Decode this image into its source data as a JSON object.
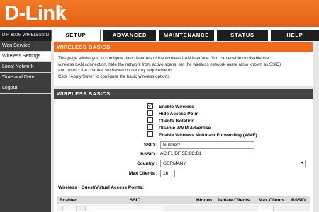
{
  "brand": {
    "logo_text": "D-Link"
  },
  "model": {
    "text": "DIR-600M WIRELESS N"
  },
  "tabs": [
    {
      "label": "SETUP",
      "active": true
    },
    {
      "label": "ADVANCED",
      "active": false
    },
    {
      "label": "MAINTENANCE",
      "active": false
    },
    {
      "label": "STATUS",
      "active": false
    },
    {
      "label": "HELP",
      "active": false
    }
  ],
  "sidebar": {
    "items": [
      {
        "label": "Wan Service"
      },
      {
        "label": "Wireless Settings",
        "active": true
      },
      {
        "label": "Local Network"
      },
      {
        "label": "Time and Date"
      },
      {
        "label": "Logout"
      }
    ]
  },
  "intro": {
    "title": "WIRELESS BASICS",
    "lines": [
      "This page allows you to configure basic features of the wireless LAN interface. You can enable or disable the",
      "wireless LAN connection, hide the network from active scans, set the wireless network name (also known as SSID)",
      "and restrict the channel set based on country requirements.",
      "Click \"Apply/Save\" to configure the basic wireless options."
    ]
  },
  "basics": {
    "title": "WIRELESS BASICS",
    "checkboxes": [
      {
        "label": "Enable Wireless",
        "checked": true
      },
      {
        "label": "Hide Access Point",
        "checked": false
      },
      {
        "label": "Clients Isolation",
        "checked": false
      },
      {
        "label": "Disable WMM Advertise",
        "checked": false
      },
      {
        "label": "Enable Wireless Multicast Forwarding (WMF)",
        "checked": false
      }
    ],
    "ssid_label": "SSID :",
    "ssid_value": "Nutmetz",
    "bssid_label": "BSSID :",
    "bssid_value": "AC:F1:DF:5E:6C:B1",
    "country_label": "Country :",
    "country_value": "GERMANY",
    "max_clients_label": "Max Clients :",
    "max_clients_value": "16",
    "guest_title": "Wireless - Guest/Virtual Access Points:",
    "guest_columns": [
      "Enabled",
      "SSID",
      "Hidden",
      "Isolate Clients",
      "Max Clients",
      "BSSID"
    ]
  },
  "colors": {
    "brand_orange": "#ef6a1d",
    "dark": "#1e1e1e",
    "sidebar": "#3c3c3c"
  },
  "icons": {
    "checkbox": "check-icon",
    "select": "chevron-down-icon"
  }
}
